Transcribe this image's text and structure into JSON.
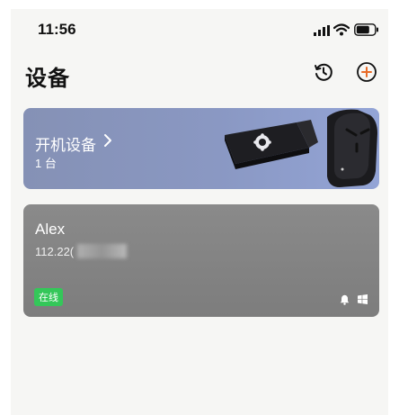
{
  "status_bar": {
    "time": "11:56",
    "icons": [
      "signal-icon",
      "wifi-icon",
      "battery-icon"
    ]
  },
  "header": {
    "title": "设备",
    "icons": [
      "history-icon",
      "add-icon"
    ],
    "accent_color": "#e86a26"
  },
  "boot_card": {
    "title": "开机设备",
    "count": "1 台",
    "icons": [
      "chevron-right-icon"
    ]
  },
  "devices": [
    {
      "name": "Alex",
      "ip": "112.22(",
      "status": "在线",
      "status_color": "#34c759",
      "icons": [
        "bell-icon",
        "windows-icon"
      ]
    }
  ]
}
